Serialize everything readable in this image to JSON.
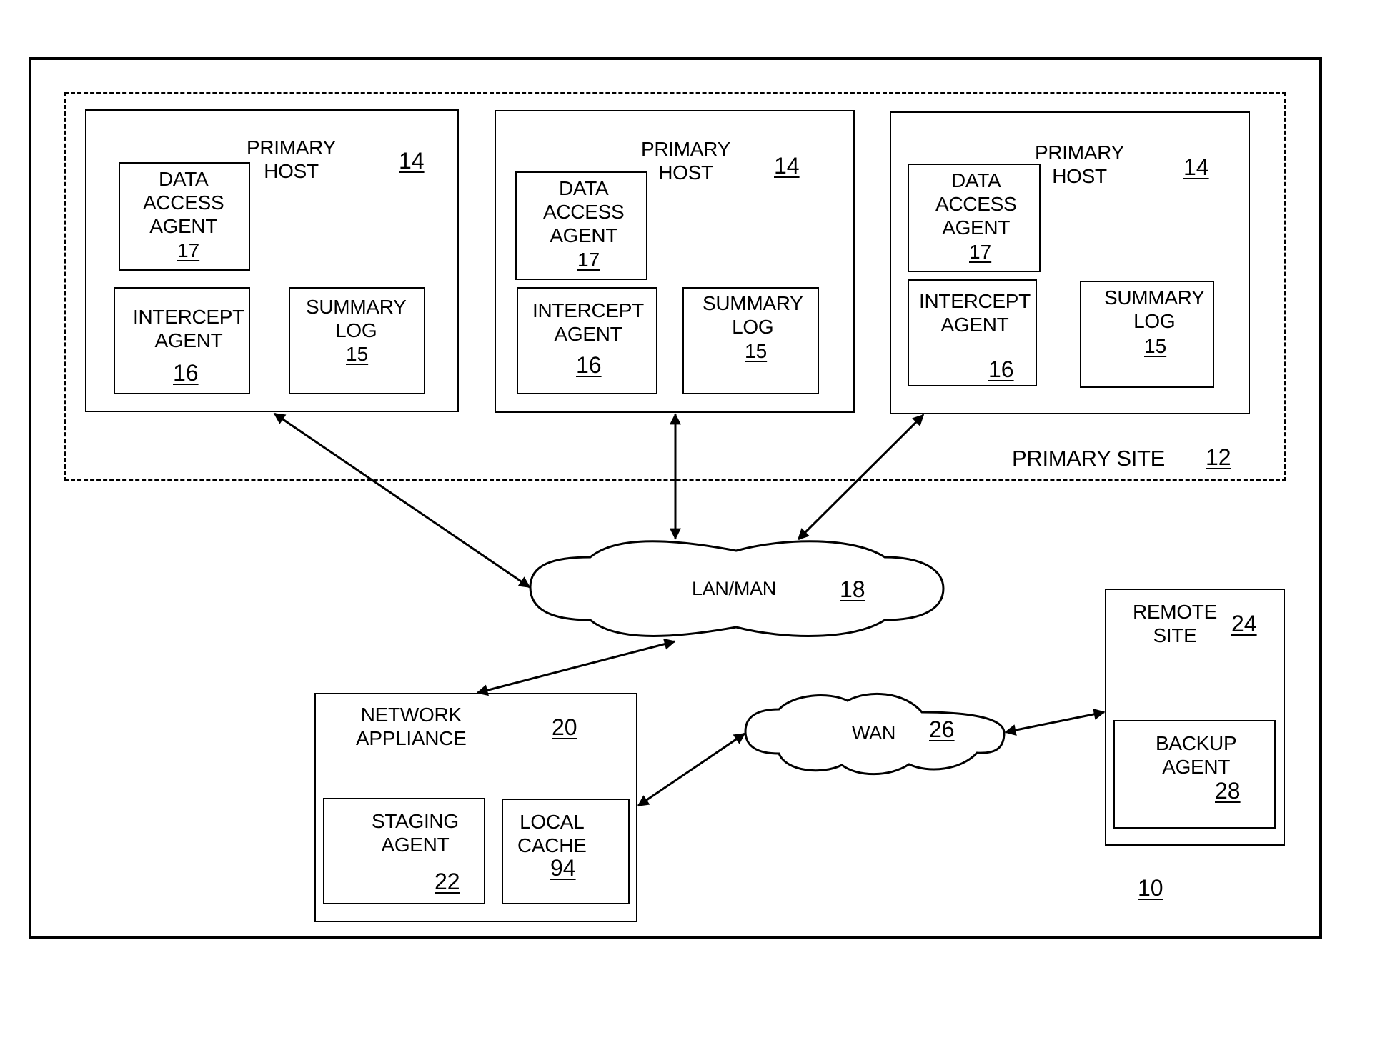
{
  "system": {
    "ref": "10"
  },
  "primary_site": {
    "label": "PRIMARY SITE",
    "ref": "12"
  },
  "primary_hosts": [
    {
      "title": "PRIMARY\nHOST",
      "ref": "14",
      "data_access_agent": {
        "label": "DATA\nACCESS\nAGENT",
        "ref": "17"
      },
      "intercept_agent": {
        "label": "INTERCEPT\nAGENT",
        "ref": "16"
      },
      "summary_log": {
        "label": "SUMMARY\nLOG",
        "ref": "15"
      }
    },
    {
      "title": "PRIMARY\nHOST",
      "ref": "14",
      "data_access_agent": {
        "label": "DATA\nACCESS\nAGENT",
        "ref": "17"
      },
      "intercept_agent": {
        "label": "INTERCEPT\nAGENT",
        "ref": "16"
      },
      "summary_log": {
        "label": "SUMMARY\nLOG",
        "ref": "15"
      }
    },
    {
      "title": "PRIMARY\nHOST",
      "ref": "14",
      "data_access_agent": {
        "label": "DATA\nACCESS\nAGENT",
        "ref": "17"
      },
      "intercept_agent": {
        "label": "INTERCEPT\nAGENT",
        "ref": "16"
      },
      "summary_log": {
        "label": "SUMMARY\nLOG",
        "ref": "15"
      }
    }
  ],
  "lan_man": {
    "label": "LAN/MAN",
    "ref": "18"
  },
  "network_appliance": {
    "title": "NETWORK\nAPPLIANCE",
    "ref": "20",
    "staging_agent": {
      "label": "STAGING\nAGENT",
      "ref": "22"
    },
    "local_cache": {
      "label": "LOCAL\nCACHE",
      "ref": "94"
    }
  },
  "wan": {
    "label": "WAN",
    "ref": "26"
  },
  "remote_site": {
    "title": "REMOTE\nSITE",
    "ref": "24",
    "backup_agent": {
      "label": "BACKUP\nAGENT",
      "ref": "28"
    }
  },
  "connections": [
    {
      "from": "primary_host_1",
      "to": "lan_man",
      "bidirectional": true
    },
    {
      "from": "primary_host_2",
      "to": "lan_man",
      "bidirectional": true
    },
    {
      "from": "primary_host_3",
      "to": "lan_man",
      "bidirectional": true
    },
    {
      "from": "lan_man",
      "to": "network_appliance",
      "bidirectional": true
    },
    {
      "from": "network_appliance",
      "to": "wan",
      "bidirectional": true
    },
    {
      "from": "wan",
      "to": "remote_site",
      "bidirectional": true
    }
  ]
}
